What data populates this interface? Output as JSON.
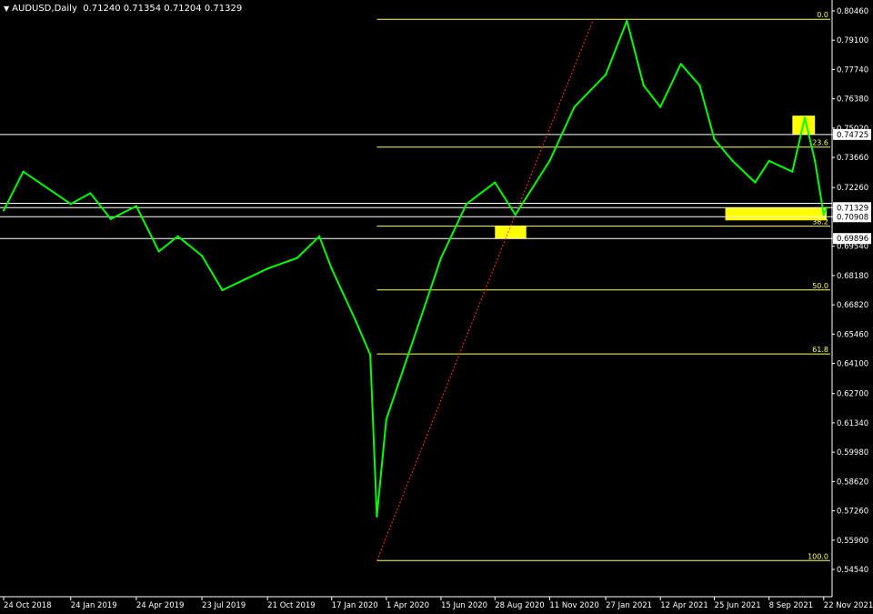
{
  "header": {
    "symbol": "AUDUSD,Daily",
    "ohlc": "0.71240 0.71354 0.71204 0.71329",
    "menu_icon": "triangle-down-icon"
  },
  "colors": {
    "background": "#000000",
    "price": "#00ff00",
    "fib": "#ffff66",
    "hline": "#ffffff",
    "trend": "#ff3030",
    "zone": "#ffff00",
    "axis": "#ffffff"
  },
  "chart_data": {
    "type": "line",
    "symbol": "AUDUSD",
    "timeframe": "Daily",
    "grid": false,
    "ylim": [
      0.5454,
      0.8046
    ],
    "y_ticks": [
      "0.80460",
      "0.79100",
      "0.77740",
      "0.76380",
      "0.75020",
      "0.74725",
      "0.73660",
      "0.72260",
      "0.71329",
      "0.70908",
      "0.69896",
      "0.69540",
      "0.68180",
      "0.66820",
      "0.65460",
      "0.64100",
      "0.62700",
      "0.61340",
      "0.59980",
      "0.58620",
      "0.57260",
      "0.55900",
      "0.54540"
    ],
    "highlighted_price_labels": [
      "0.74725",
      "0.71329",
      "0.70908",
      "0.69896"
    ],
    "x_ticks": [
      "24 Oct 2018",
      "24 Jan 2019",
      "24 Apr 2019",
      "23 Jul 2019",
      "21 Oct 2019",
      "17 Jan 2020",
      "1 Apr 2020",
      "15 Jun 2020",
      "28 Aug 2020",
      "11 Nov 2020",
      "27 Jan 2021",
      "12 Apr 2021",
      "25 Jun 2021",
      "8 Sep 2021",
      "22 Nov 2021"
    ],
    "series": [
      {
        "x": [
          "24 Oct 2018",
          "2018-11-20",
          "24 Jan 2019",
          "2019-02-20",
          "2019-03-20",
          "24 Apr 2019",
          "2019-05-25",
          "2019-06-20",
          "23 Jul 2019",
          "2019-08-20",
          "2019-09-20",
          "21 Oct 2019",
          "2019-12-01",
          "2019-12-31",
          "17 Jan 2020",
          "2020-02-20",
          "2020-03-10",
          "2020-03-19",
          "1 Apr 2020",
          "2020-05-01",
          "15 Jun 2020",
          "2020-07-20",
          "28 Aug 2020",
          "2020-09-25",
          "11 Nov 2020",
          "2020-12-15",
          "27 Jan 2021",
          "2021-02-25",
          "2021-03-20",
          "12 Apr 2021",
          "2021-05-10",
          "2021-06-05",
          "25 Jun 2021",
          "2021-07-20",
          "2021-08-20",
          "8 Sep 2021",
          "2021-10-10",
          "2021-10-27",
          "2021-11-10",
          "22 Nov 2021",
          "2021-11-26"
        ],
        "y": [
          0.712,
          0.73,
          0.715,
          0.72,
          0.708,
          0.714,
          0.693,
          0.7,
          0.691,
          0.675,
          0.68,
          0.685,
          0.69,
          0.7,
          0.685,
          0.66,
          0.645,
          0.57,
          0.615,
          0.645,
          0.69,
          0.715,
          0.725,
          0.71,
          0.735,
          0.76,
          0.775,
          0.8,
          0.77,
          0.76,
          0.78,
          0.77,
          0.745,
          0.735,
          0.725,
          0.735,
          0.73,
          0.755,
          0.735,
          0.71,
          0.7133
        ]
      }
    ],
    "fibonacci": {
      "levels": [
        {
          "label": "0.0",
          "price": 0.8007
        },
        {
          "label": "23.6",
          "price": 0.7414
        },
        {
          "label": "38.2",
          "price": 0.7047
        },
        {
          "label": "50.0",
          "price": 0.6751
        },
        {
          "label": "61.8",
          "price": 0.6454
        },
        {
          "label": "100.0",
          "price": 0.5495
        }
      ],
      "start": "2020-03-19",
      "end": "2021-11-26"
    },
    "horizontal_lines": [
      0.74725,
      0.71529,
      0.71329,
      0.70908,
      0.69896
    ],
    "trendline": {
      "from": {
        "x": "2020-03-19",
        "y": 0.5495
      },
      "to": {
        "x": "2021-01-10",
        "y": 0.8007
      }
    },
    "zones": [
      {
        "x0": "2020-08-28",
        "x1": "2020-10-10",
        "y0": 0.699,
        "y1": 0.705
      },
      {
        "x0": "2021-10-10",
        "x1": "2021-11-10",
        "y0": 0.7472,
        "y1": 0.756
      },
      {
        "x0": "2021-07-10",
        "x1": "2021-11-26",
        "y0": 0.7074,
        "y1": 0.7133
      }
    ]
  }
}
